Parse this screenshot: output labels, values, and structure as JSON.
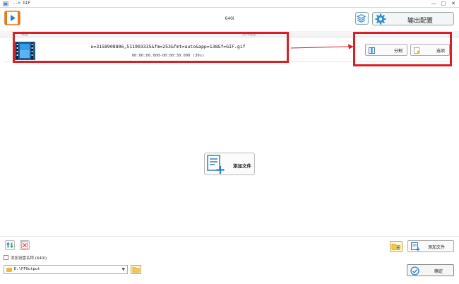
{
  "window": {
    "title": "--> GIF",
    "controls": [
      "—",
      "□",
      "✕"
    ]
  },
  "toolbar": {
    "preset_label": "640i",
    "output_config_label": "输出配置"
  },
  "list": {
    "header_left": "预览",
    "header_middle": "文件信息",
    "file": {
      "name": "u=3158908806,511903335&fm=253&fmt=auto&app=138&f=GIF.gif",
      "range": "00:00:00.000-00:00:30.000 (30s)",
      "split_label": "分割",
      "options_label": "选项"
    },
    "add_file_center_label": "添加文件"
  },
  "bottom": {
    "checkbox_label": "添加设置名称 (640i)",
    "output_path": "D:\\FFOutput",
    "add_file_label": "添加文件",
    "ok_label": "确定"
  },
  "colors": {
    "highlight": "#d81e27",
    "accent": "#2e7fc1",
    "folder": "#e9b941"
  }
}
